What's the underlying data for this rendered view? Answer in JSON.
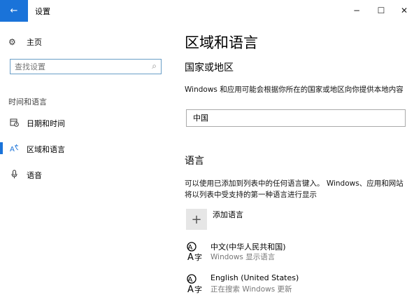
{
  "window": {
    "title": "设置",
    "back_glyph": "←",
    "minimize_glyph": "−",
    "maximize_glyph": "☐",
    "close_glyph": "✕"
  },
  "sidebar": {
    "home": {
      "label": "主页",
      "icon": "gear-icon"
    },
    "search": {
      "placeholder": "查找设置",
      "icon": "search-icon"
    },
    "section_title": "时间和语言",
    "items": [
      {
        "label": "日期和时间",
        "icon": "calendar-clock-icon",
        "active": false
      },
      {
        "label": "区域和语言",
        "icon": "region-language-icon",
        "active": true
      },
      {
        "label": "语音",
        "icon": "microphone-icon",
        "active": false
      }
    ]
  },
  "main": {
    "title": "区域和语言",
    "region": {
      "heading": "国家或地区",
      "description": "Windows 和应用可能会根据你所在的国家或地区向你提供本地内容",
      "value": "中国"
    },
    "language": {
      "heading": "语言",
      "description": "可以使用已添加到列表中的任何语言键入。 Windows、应用和网站将以列表中受支持的第一种语言进行显示",
      "add_label": "添加语言",
      "add_icon": "plus-icon",
      "items": [
        {
          "name": "中文(中华人民共和国)",
          "status": "Windows 显示语言",
          "icon": "language-icon"
        },
        {
          "name": "English (United States)",
          "status": "正在搜索 Windows 更新",
          "icon": "language-icon"
        }
      ]
    }
  },
  "colors": {
    "accent": "#1a73d9"
  }
}
